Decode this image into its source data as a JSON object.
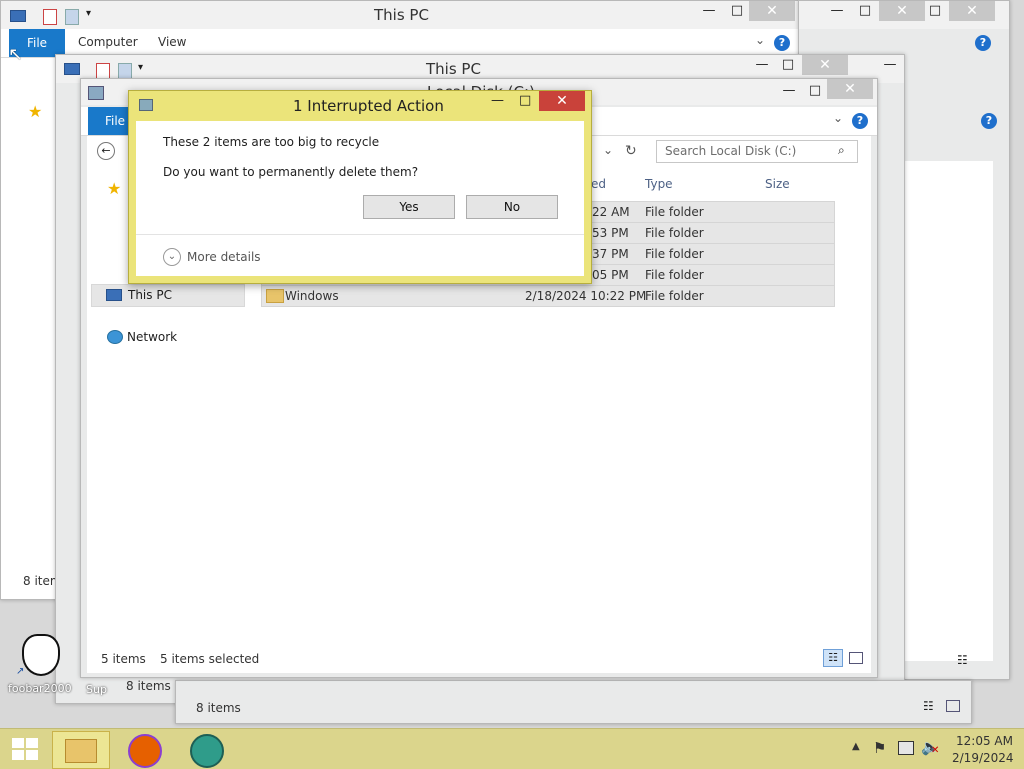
{
  "back_window_1": {
    "title": "This PC",
    "file_tab": "File",
    "tabs": [
      "Computer",
      "View"
    ],
    "status": "8 items"
  },
  "back_window_2": {
    "title": "This PC",
    "status": "8 items"
  },
  "back_window_3": {
    "status": "8 items"
  },
  "explorer": {
    "title": "Local Disk (C:)",
    "file_tab": "File",
    "search_placeholder": "Search Local Disk (C:)",
    "columns": {
      "date": "ed",
      "type": "Type",
      "size": "Size"
    },
    "rows": [
      {
        "name": "",
        "date": "22 AM",
        "type": "File folder"
      },
      {
        "name": "",
        "date": "53 PM",
        "type": "File folder"
      },
      {
        "name": "",
        "date": "37 PM",
        "type": "File folder"
      },
      {
        "name": "",
        "date": "05 PM",
        "type": "File folder"
      },
      {
        "name": "Windows",
        "date": "2/18/2024 10:22 PM",
        "type": "File folder"
      }
    ],
    "nav": {
      "this_pc": "This PC",
      "network": "Network"
    },
    "status_items": "5 items",
    "status_selected": "5 items selected"
  },
  "dialog": {
    "title": "1 Interrupted Action",
    "message": "These 2 items are too big to recycle",
    "question": "Do you want to permanently delete them?",
    "yes_label": "Yes",
    "no_label": "No",
    "more_details": "More details"
  },
  "desktop": {
    "foobar_label": "foobar2000",
    "partial_label": "Sup"
  },
  "taskbar": {
    "time": "12:05 AM",
    "date": "2/19/2024"
  },
  "colors": {
    "accent": "#1979ca",
    "dialog_frame": "#ebe47a",
    "taskbar": "#dbd58c",
    "close_red": "#c9423a"
  }
}
